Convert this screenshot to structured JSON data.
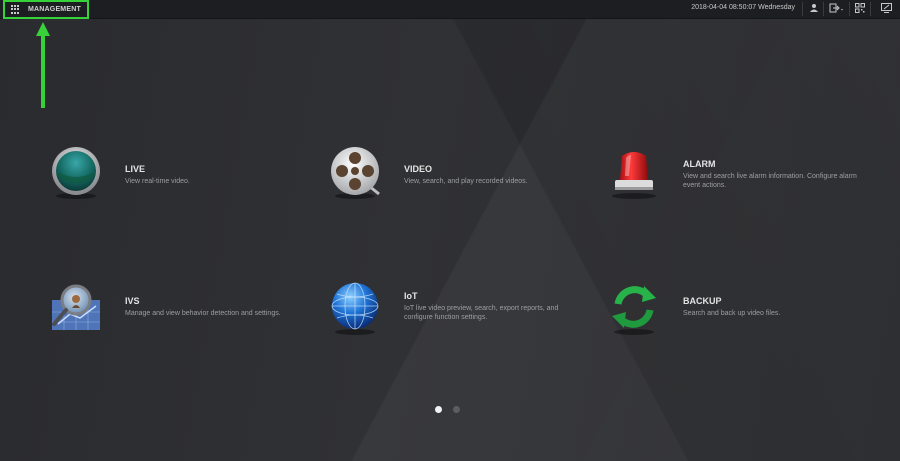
{
  "topbar": {
    "management_label": "MANAGEMENT",
    "datetime": "2018-04-04 08:50:07 Wednesday",
    "icons": [
      "user-icon",
      "logout-icon",
      "qr-code-icon",
      "display-settings-icon"
    ]
  },
  "apps": [
    {
      "title": "LIVE",
      "description": "View real-time video.",
      "icon": "live-icon"
    },
    {
      "title": "VIDEO",
      "description": "View, search, and play recorded videos.",
      "icon": "video-reel-icon"
    },
    {
      "title": "ALARM",
      "description": "View and search live alarm information. Configure alarm event actions.",
      "icon": "alarm-siren-icon"
    },
    {
      "title": "IVS",
      "description": "Manage and view behavior detection and settings.",
      "icon": "ivs-magnifier-icon"
    },
    {
      "title": "IoT",
      "description": "IoT live video preview, search, export reports, and configure function settings.",
      "icon": "globe-icon"
    },
    {
      "title": "BACKUP",
      "description": "Search and back up video files.",
      "icon": "backup-arrows-icon"
    }
  ],
  "pager": {
    "pages": 2,
    "current": 1
  },
  "colors": {
    "highlight": "#37d13a",
    "background": "#2c2d31",
    "topbar": "#1d1e21"
  }
}
